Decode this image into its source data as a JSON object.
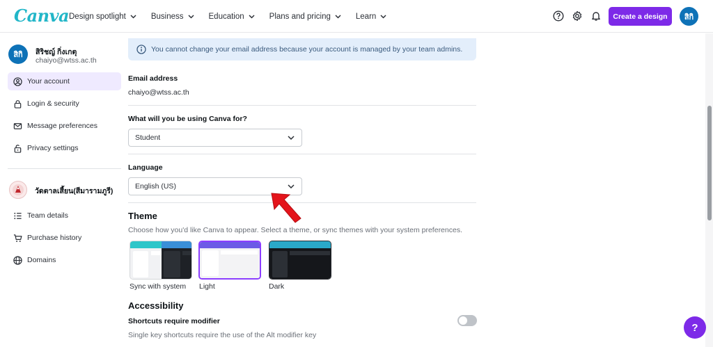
{
  "brand": {
    "logo": "Canva",
    "accent": "#7d2ae8",
    "logo_color": "#22b6c8"
  },
  "nav": {
    "items": [
      "Design spotlight",
      "Business",
      "Education",
      "Plans and pricing",
      "Learn"
    ],
    "create_label": "Create a design",
    "avatar_initials": "สิกิ",
    "icons": [
      "help-icon",
      "settings-icon",
      "bell-icon"
    ]
  },
  "profile": {
    "avatar_initials": "สิกิ",
    "name": "สิริชญ์ กิ่งเกตุ",
    "email": "chaiyo@wtss.ac.th"
  },
  "sidebar": {
    "items": [
      {
        "label": "Your account",
        "icon": "user-circle-icon",
        "active": true
      },
      {
        "label": "Login & security",
        "icon": "lock-icon"
      },
      {
        "label": "Message preferences",
        "icon": "mail-icon"
      },
      {
        "label": "Privacy settings",
        "icon": "privacy-lock-icon"
      }
    ],
    "team_name": "วัดตาลเสี้ยน(สีมารามภูรี)",
    "team_items": [
      {
        "label": "Team details",
        "icon": "list-icon"
      },
      {
        "label": "Purchase history",
        "icon": "cart-icon"
      },
      {
        "label": "Domains",
        "icon": "globe-icon"
      }
    ]
  },
  "main": {
    "banner": "You cannot change your email address because your account is managed by your team admins.",
    "email_label": "Email address",
    "email_value": "chaiyo@wtss.ac.th",
    "usage_label": "What will you be using Canva for?",
    "usage_value": "Student",
    "language_label": "Language",
    "language_value": "English (US)",
    "theme_title": "Theme",
    "theme_desc": "Choose how you'd like Canva to appear. Select a theme, or sync themes with your system preferences.",
    "themes": [
      {
        "label": "Sync with system",
        "selected": false
      },
      {
        "label": "Light",
        "selected": true
      },
      {
        "label": "Dark",
        "selected": false
      }
    ],
    "accessibility_title": "Accessibility",
    "shortcuts_label": "Shortcuts require modifier",
    "shortcuts_desc": "Single key shortcuts require the use of the Alt modifier key",
    "shortcuts_enabled": false
  },
  "help_fab": "?"
}
